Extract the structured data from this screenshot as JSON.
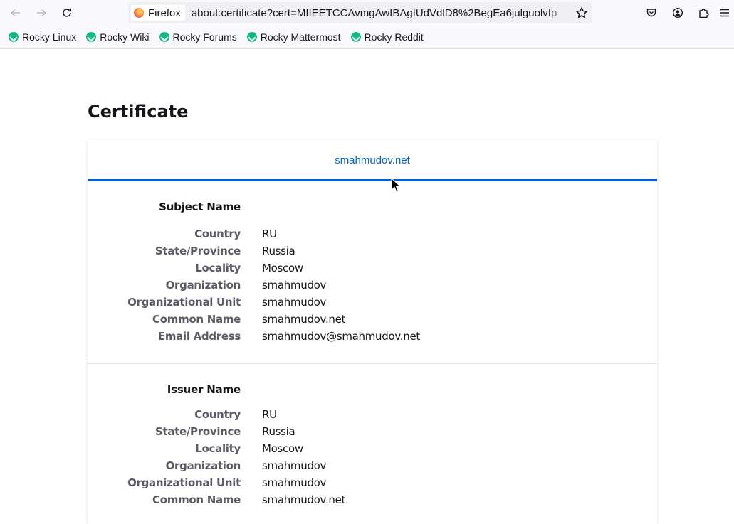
{
  "browser": {
    "identity_label": "Firefox",
    "url": "about:certificate?cert=MIIEETCCAvmgAwIBAgIUdVdlD8%2BegEa6julguolvfp",
    "bookmarks": [
      {
        "label": "Rocky Linux"
      },
      {
        "label": "Rocky Wiki"
      },
      {
        "label": "Rocky Forums"
      },
      {
        "label": "Rocky Mattermost"
      },
      {
        "label": "Rocky Reddit"
      }
    ]
  },
  "page": {
    "title": "Certificate",
    "tab": "smahmudov.net"
  },
  "subject": {
    "title": "Subject Name",
    "fields": [
      {
        "label": "Country",
        "value": "RU"
      },
      {
        "label": "State/Province",
        "value": "Russia"
      },
      {
        "label": "Locality",
        "value": "Moscow"
      },
      {
        "label": "Organization",
        "value": "smahmudov"
      },
      {
        "label": "Organizational Unit",
        "value": "smahmudov"
      },
      {
        "label": "Common Name",
        "value": "smahmudov.net"
      },
      {
        "label": "Email Address",
        "value": "smahmudov@smahmudov.net"
      }
    ]
  },
  "issuer": {
    "title": "Issuer Name",
    "fields": [
      {
        "label": "Country",
        "value": "RU"
      },
      {
        "label": "State/Province",
        "value": "Russia"
      },
      {
        "label": "Locality",
        "value": "Moscow"
      },
      {
        "label": "Organization",
        "value": "smahmudov"
      },
      {
        "label": "Organizational Unit",
        "value": "smahmudov"
      },
      {
        "label": "Common Name",
        "value": "smahmudov.net"
      }
    ]
  },
  "colors": {
    "accent": "#0060df",
    "bookmark_icon": "#10b981"
  }
}
